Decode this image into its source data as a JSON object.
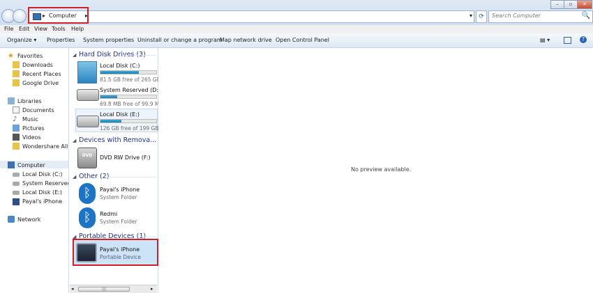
{
  "address": {
    "crumb": "Computer",
    "arrow": "▸",
    "dropdown": "▾"
  },
  "search": {
    "placeholder": "Search Computer",
    "icon": "🔍"
  },
  "window_buttons": {
    "minimize": "–",
    "maximize": "▫",
    "close": "✕"
  },
  "menu": {
    "file": "File",
    "edit": "Edit",
    "view": "View",
    "tools": "Tools",
    "help": "Help"
  },
  "commands": {
    "organize": "Organize ▾",
    "properties": "Properties",
    "system_properties": "System properties",
    "uninstall": "Uninstall or change a program",
    "map_drive": "Map network drive",
    "control_panel": "Open Control Panel",
    "views": "▤ ▾",
    "help": "?"
  },
  "nav": {
    "favorites": "Favorites",
    "downloads": "Downloads",
    "recent": "Recent Places",
    "gdrive": "Google Drive",
    "libraries": "Libraries",
    "documents": "Documents",
    "music": "Music",
    "pictures": "Pictures",
    "videos": "Videos",
    "wondershare": "Wondershare AllMy",
    "computer": "Computer",
    "local_c": "Local Disk (C:)",
    "system_reserved": "System Reserved (D:",
    "local_e": "Local Disk (E:)",
    "iphone": "Payal's iPhone",
    "network": "Network"
  },
  "groups": {
    "hdd": "Hard Disk Drives (3)",
    "removable": "Devices with Remova... (1)",
    "other": "Other (2)",
    "portable": "Portable Devices (1)"
  },
  "drives": [
    {
      "name": "Local Disk (C:)",
      "free": "81.5 GB free of 265 GB",
      "used_fraction": 0.69
    },
    {
      "name": "System Reserved (D:)",
      "free": "69.8 MB free of 99.9 MB",
      "used_fraction": 0.3
    },
    {
      "name": "Local Disk (E:)",
      "free": "126 GB free of 199 GB",
      "used_fraction": 0.37
    }
  ],
  "dvd": {
    "name": "DVD RW Drive (F:)",
    "badge": "DVD"
  },
  "other_items": [
    {
      "name": "Payal's iPhone",
      "sub": "System Folder"
    },
    {
      "name": "Redmi",
      "sub": "System Folder"
    }
  ],
  "portable_item": {
    "name": "Payal's iPhone",
    "sub": "Portable Device"
  },
  "preview": {
    "text": "No preview available."
  },
  "scroll": {
    "grip": "|||"
  }
}
